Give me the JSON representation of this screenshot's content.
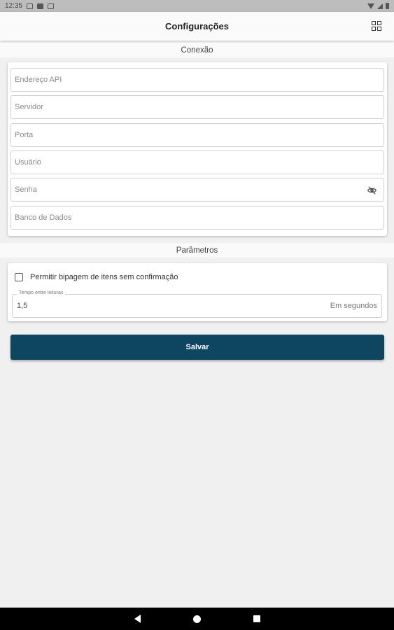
{
  "status_bar": {
    "time": "12:35"
  },
  "app_bar": {
    "title": "Configurações",
    "action_icon": "qr-code-icon"
  },
  "sections": {
    "connection": {
      "title": "Conexão",
      "fields": {
        "api_address": {
          "placeholder": "Endereço API"
        },
        "server": {
          "placeholder": "Servidor"
        },
        "port": {
          "placeholder": "Porta"
        },
        "user": {
          "placeholder": "Usuário"
        },
        "password": {
          "placeholder": "Senha",
          "icon": "eye-off-icon"
        },
        "database": {
          "placeholder": "Banco de Dados"
        }
      }
    },
    "parameters": {
      "title": "Parâmetros",
      "allow_scan_label": "Permitir bipagem de itens sem confirmação",
      "allow_scan_checked": false,
      "read_interval": {
        "label": "Tempo entre leituras",
        "value": "1,5",
        "suffix": "Em segundos"
      }
    }
  },
  "save_button": {
    "label": "Salvar",
    "color": "#0e4561"
  },
  "nav_bar": {
    "icons": [
      "back-icon",
      "home-icon",
      "recents-icon"
    ]
  }
}
